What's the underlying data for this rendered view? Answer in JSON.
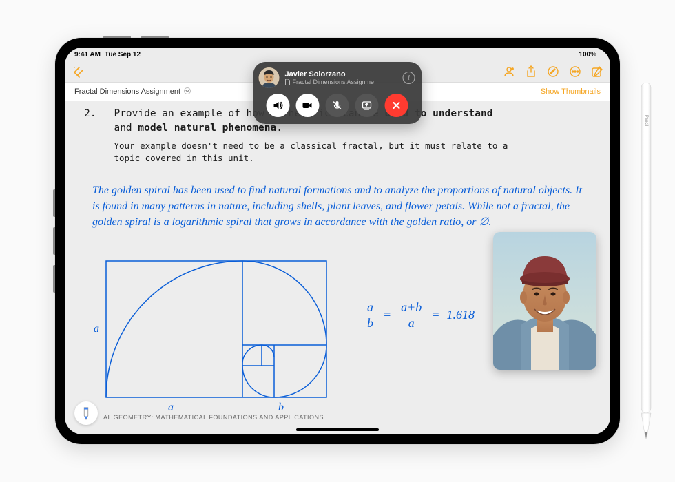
{
  "statusbar": {
    "time": "9:41 AM",
    "date": "Tue Sep 12",
    "battery_pct": "100%"
  },
  "toolbar": {
    "collapse_icon": "collapse-sidebar-icon",
    "icons": [
      "collaborate",
      "share",
      "markup",
      "more",
      "compose"
    ]
  },
  "docbar": {
    "title": "Fractal Dimensions Assignment",
    "show_thumbnails": "Show Thumbnails"
  },
  "question": {
    "number": "2.",
    "prompt_pre": "Provide an example of how mathematics can be ",
    "prompt_bold1": "used to understand",
    "prompt_mid": " and ",
    "prompt_bold2": "model natural phenomena",
    "prompt_end": ".",
    "subtext": "Your example doesn't need to be a classical fractal, but it must relate to a topic covered in this unit."
  },
  "handwritten": "The golden spiral has been used to find natural formations and to analyze the proportions of natural objects. It is found in many patterns in nature, including shells, plant leaves, and flower petals. While not a fractal, the golden spiral is a logarithmic spiral that grows in accordance with the golden ratio, or ∅.",
  "spiral_labels": {
    "a_side": "a",
    "a_bottom": "a",
    "b_bottom": "b"
  },
  "equation": {
    "lhs_top": "a",
    "lhs_bot": "b",
    "rhs_top": "a+b",
    "rhs_bot": "a",
    "result": "1.618",
    "eq": "="
  },
  "footer": "AL GEOMETRY: MATHEMATICAL FOUNDATIONS AND APPLICATIONS",
  "facetime": {
    "caller_name": "Javier Solorzano",
    "doc_share": "Fractal Dimensions Assignme",
    "info": "i",
    "buttons": [
      "speaker",
      "camera",
      "mic-off",
      "screenshare",
      "end-call"
    ]
  },
  "pencil_label": "Pencil"
}
